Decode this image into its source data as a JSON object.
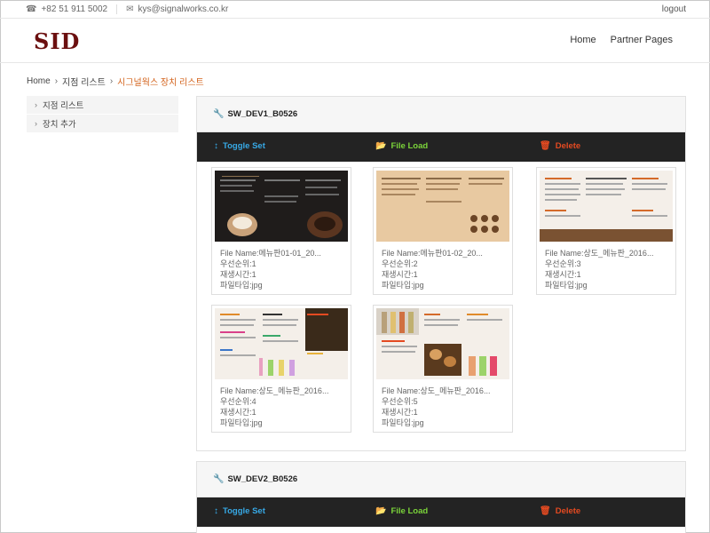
{
  "topbar": {
    "phone": "+82 51 911 5002",
    "email": "kys@signalworks.co.kr",
    "logout": "logout"
  },
  "header": {
    "logo": "SID",
    "nav": [
      "Home",
      "Partner Pages"
    ]
  },
  "breadcrumb": [
    "Home",
    "지점 리스트",
    "시그널웍스 장치 리스트"
  ],
  "sidebar": {
    "items": [
      {
        "label": "지점 리스트"
      },
      {
        "label": "장치 추가"
      }
    ]
  },
  "toolbar": {
    "toggle_label": "Toggle Set",
    "file_label": "File Load",
    "delete_label": "Delete"
  },
  "devices": [
    {
      "name": "SW_DEV1_B0526",
      "files": [
        {
          "file_name": "File Name:메뉴판01-01_20...",
          "priority": "우선순위:1",
          "play_time": "재생시간:1",
          "file_type": "파일타입:jpg",
          "thumb": "dark"
        },
        {
          "file_name": "File Name:메뉴판01-02_20...",
          "priority": "우선순위:2",
          "play_time": "재생시간:1",
          "file_type": "파일타입:jpg",
          "thumb": "tan"
        },
        {
          "file_name": "File Name:상도_메뉴판_2016...",
          "priority": "우선순위:3",
          "play_time": "재생시간:1",
          "file_type": "파일타입:jpg",
          "thumb": "white"
        },
        {
          "file_name": "File Name:상도_메뉴판_2016...",
          "priority": "우선순위:4",
          "play_time": "재생시간:1",
          "file_type": "파일타입:jpg",
          "thumb": "white-drinks"
        },
        {
          "file_name": "File Name:상도_메뉴판_2016...",
          "priority": "우선순위:5",
          "play_time": "재생시간:1",
          "file_type": "파일타입:jpg",
          "thumb": "white-bakery"
        }
      ]
    },
    {
      "name": "SW_DEV2_B0526",
      "files": []
    }
  ],
  "colors": {
    "toggle": "#37a9e6",
    "file_load": "#7bd43a",
    "delete": "#e44a21",
    "breadcrumb_active": "#d3621b",
    "logo": "#6b0f0f",
    "toolbar_bg": "#232323"
  }
}
